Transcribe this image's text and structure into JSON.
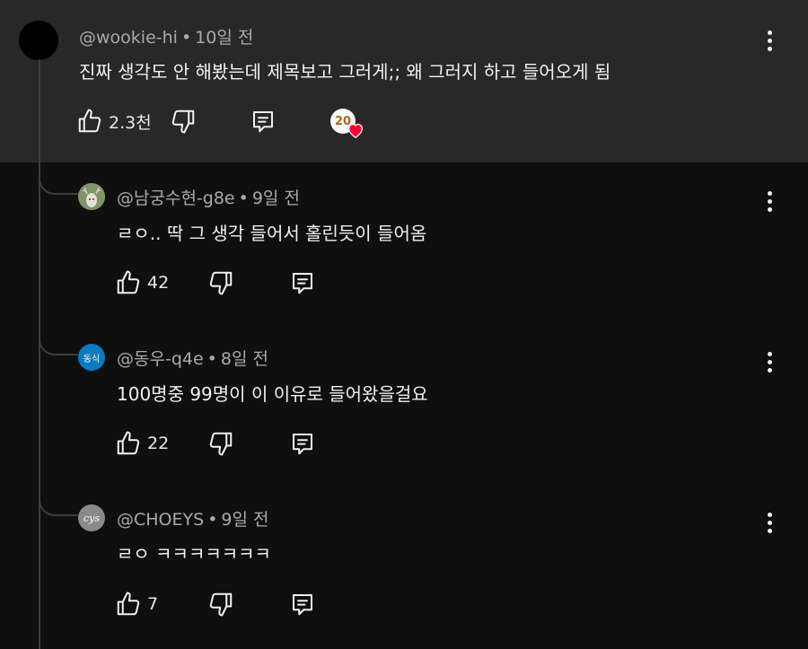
{
  "top_comment": {
    "author": "@wookie-hi",
    "time": "10일 전",
    "text": "진짜 생각도 안 해봤는데 제목보고 그러게;; 왜 그러지 하고 들어오게 됨",
    "likes": "2.3천",
    "creator_badge_text": "20"
  },
  "replies": [
    {
      "author": "@남궁수현-g8e",
      "time": "9일 전",
      "text": "ㄹㅇ.. 딱 그 생각 들어서 홀린듯이 들어옴",
      "likes": "42"
    },
    {
      "author": "@동우-q4e",
      "avatar_text": "동식",
      "time": "8일 전",
      "text": "100명중 99명이 이 이유로 들어왔을걸요",
      "likes": "22"
    },
    {
      "author": "@CHOEYS",
      "avatar_text": "cys",
      "time": "9일 전",
      "text": "ㄹㅇ ㅋㅋㅋㅋㅋㅋㅋ",
      "likes": "7"
    }
  ],
  "separator": "•",
  "icons": [
    "like-icon",
    "dislike-icon",
    "reply-icon",
    "more-options-icon",
    "creator-heart-icon"
  ],
  "colors": {
    "background": "#0f0f0f",
    "highlight": "#282828",
    "heart": "#ff0033",
    "secondary_text": "#aaaaaa",
    "thread_line": "#3d3d3d"
  }
}
